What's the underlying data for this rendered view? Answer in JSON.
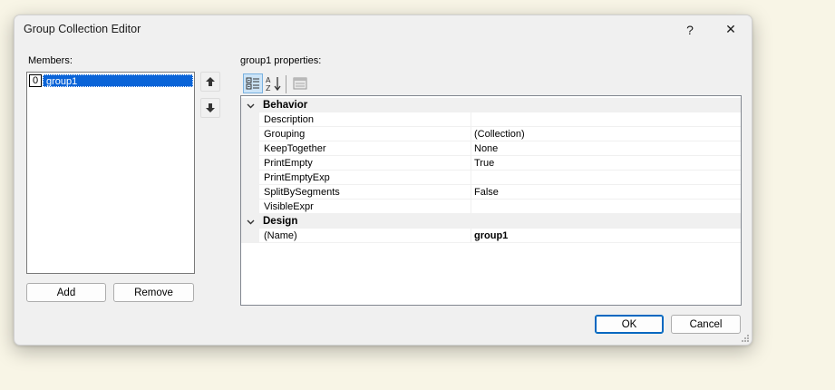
{
  "dialog": {
    "title": "Group Collection Editor",
    "help_glyph": "?",
    "close_glyph": "✕"
  },
  "members": {
    "label": "Members:",
    "items": [
      {
        "index": "0",
        "name": "group1",
        "selected": true
      }
    ],
    "add_label": "Add",
    "remove_label": "Remove"
  },
  "properties": {
    "label": "group1 properties:",
    "categories": [
      {
        "name": "Behavior",
        "expanded": true,
        "items": [
          {
            "name": "Description",
            "value": ""
          },
          {
            "name": "Grouping",
            "value": "(Collection)"
          },
          {
            "name": "KeepTogether",
            "value": "None"
          },
          {
            "name": "PrintEmpty",
            "value": "True"
          },
          {
            "name": "PrintEmptyExp",
            "value": ""
          },
          {
            "name": "SplitBySegments",
            "value": "False"
          },
          {
            "name": "VisibleExpr",
            "value": ""
          }
        ]
      },
      {
        "name": "Design",
        "expanded": true,
        "items": [
          {
            "name": "(Name)",
            "value": "group1",
            "bold": true
          }
        ]
      }
    ]
  },
  "footer": {
    "ok_label": "OK",
    "cancel_label": "Cancel"
  },
  "colors": {
    "selection": "#0a64d8",
    "accent": "#0067c0",
    "background": "#f8f5e6"
  }
}
